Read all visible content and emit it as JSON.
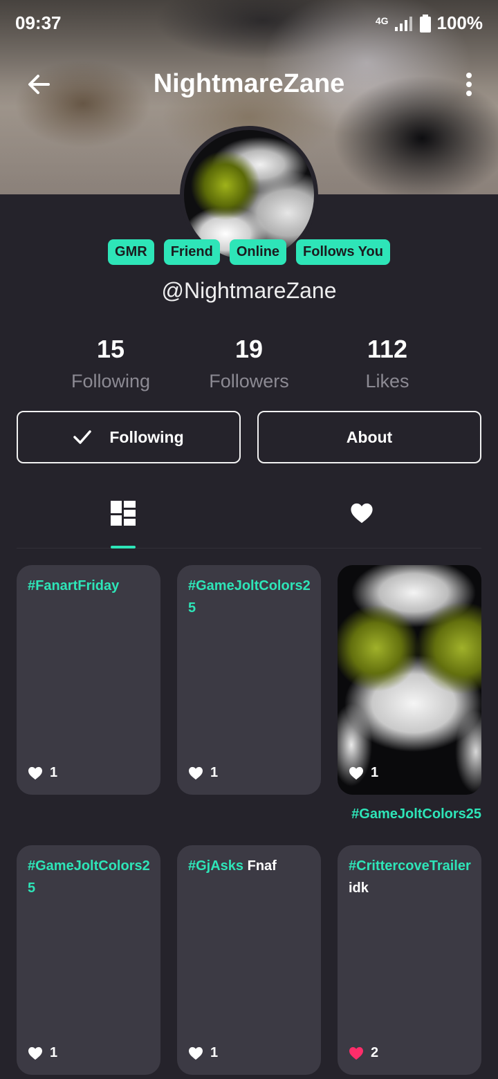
{
  "status_bar": {
    "time": "09:37",
    "network": "4G",
    "battery": "100%"
  },
  "header": {
    "title": "NightmareZane"
  },
  "profile": {
    "badges": [
      "GMR",
      "Friend",
      "Online",
      "Follows You"
    ],
    "handle": "@NightmareZane",
    "stats": [
      {
        "value": "15",
        "label": "Following"
      },
      {
        "value": "19",
        "label": "Followers"
      },
      {
        "value": "112",
        "label": "Likes"
      }
    ],
    "actions": {
      "following_label": "Following",
      "about_label": "About"
    }
  },
  "tabs": [
    {
      "icon": "dashboard-grid-icon",
      "active": true
    },
    {
      "icon": "heart-icon",
      "active": false
    }
  ],
  "posts": [
    {
      "hashtag": "#FanartFriday",
      "text": "",
      "likes": "1",
      "liked": false
    },
    {
      "hashtag": "#GameJoltColors25",
      "text": "",
      "likes": "1",
      "liked": false
    },
    {
      "hashtag": "",
      "text": "",
      "likes": "1",
      "liked": false,
      "caption": "#GameJoltColors25"
    },
    {
      "hashtag": "#GameJoltColors25",
      "text": "",
      "likes": "1",
      "liked": false
    },
    {
      "hashtag": "#GjAsks",
      "text": " Fnaf",
      "likes": "1",
      "liked": false
    },
    {
      "hashtag": "#CrittercoveTrailer",
      "text": " idk",
      "likes": "2",
      "liked": true
    }
  ],
  "colors": {
    "accent": "#2ee5b8",
    "background": "#25232b",
    "card": "#3c3a44",
    "like_active": "#ff2d6a"
  }
}
